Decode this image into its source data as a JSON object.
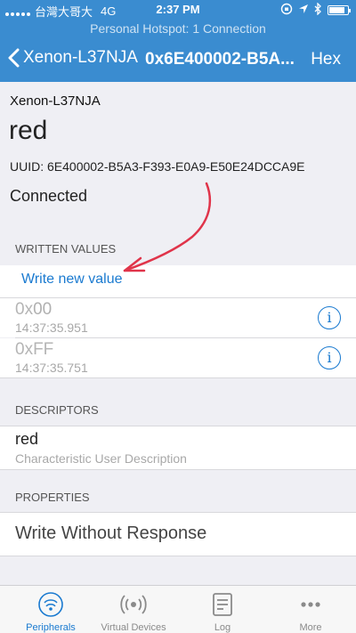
{
  "status_bar": {
    "carrier": "台灣大哥大",
    "network": "4G",
    "time": "2:37 PM"
  },
  "hotspot": {
    "text": "Personal Hotspot: 1 Connection"
  },
  "navbar": {
    "back_label": "Xenon-L37NJA",
    "title": "0x6E400002-B5A...",
    "hex_label": "Hex"
  },
  "info": {
    "device_name": "Xenon-L37NJA",
    "characteristic_name": "red",
    "uuid": "UUID: 6E400002-B5A3-F393-E0A9-E50E24DCCA9E",
    "state": "Connected"
  },
  "written_values": {
    "header": "WRITTEN VALUES",
    "write_new_label": "Write new value",
    "items": [
      {
        "prefix": "0x",
        "value": "00",
        "time": "14:37:35.951"
      },
      {
        "prefix": "0x",
        "value": "FF",
        "time": "14:37:35.751"
      }
    ]
  },
  "descriptors": {
    "header": "DESCRIPTORS",
    "name": "red",
    "subtitle": "Characteristic User Description"
  },
  "properties": {
    "header": "PROPERTIES",
    "value": "Write Without Response"
  },
  "tabs": [
    {
      "label": "Peripherals",
      "icon": "peripherals-icon",
      "active": true
    },
    {
      "label": "Virtual Devices",
      "icon": "virtual-devices-icon",
      "active": false
    },
    {
      "label": "Log",
      "icon": "log-icon",
      "active": false
    },
    {
      "label": "More",
      "icon": "more-icon",
      "active": false
    }
  ],
  "colors": {
    "accent": "#3a8cd0",
    "link": "#1a7ad0",
    "annotation": "#e0344a"
  }
}
